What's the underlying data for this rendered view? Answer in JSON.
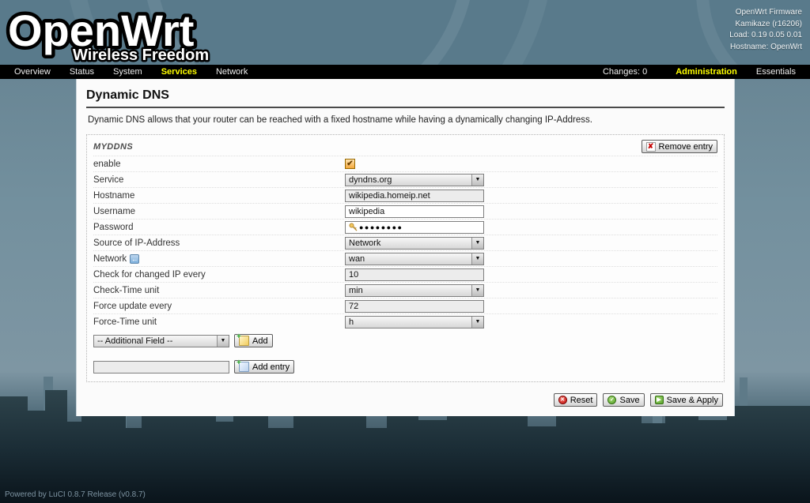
{
  "header": {
    "logo_title": "OpenWrt",
    "logo_subtitle": "Wireless Freedom",
    "info_lines": [
      "OpenWrt Firmware",
      "Kamikaze (r16206)",
      "Load: 0.19 0.05 0.01",
      "Hostname: OpenWrt"
    ]
  },
  "nav": {
    "items": [
      "Overview",
      "Status",
      "System",
      "Services",
      "Network"
    ],
    "active_item": "Services",
    "changes": "Changes: 0",
    "right_items": [
      "Administration",
      "Essentials"
    ],
    "accent_color": "#ffff00"
  },
  "page": {
    "title": "Dynamic DNS",
    "description": "Dynamic DNS allows that your router can be reached with a fixed hostname while having a dynamically changing IP-Address.",
    "section": {
      "name": "MYDDNS",
      "remove_button": "Remove entry",
      "rows": [
        {
          "id": "enable",
          "label": "enable",
          "type": "checkbox",
          "checked": true
        },
        {
          "id": "service",
          "label": "Service",
          "type": "select",
          "value": "dyndns.org"
        },
        {
          "id": "hostname",
          "label": "Hostname",
          "type": "text",
          "value": "wikipedia.homeip.net",
          "shaded": true
        },
        {
          "id": "username",
          "label": "Username",
          "type": "text",
          "value": "wikipedia"
        },
        {
          "id": "password",
          "label": "Password",
          "type": "password",
          "value": "●●●●●●●●"
        },
        {
          "id": "ip-source",
          "label": "Source of IP-Address",
          "type": "select",
          "value": "Network"
        },
        {
          "id": "network",
          "label": "Network",
          "type": "select",
          "value": "wan",
          "revert_icon": true
        },
        {
          "id": "check-interval",
          "label": "Check for changed IP every",
          "type": "text",
          "value": "10",
          "shaded": true
        },
        {
          "id": "check-unit",
          "label": "Check-Time unit",
          "type": "select",
          "value": "min"
        },
        {
          "id": "force-interval",
          "label": "Force update every",
          "type": "text",
          "value": "72",
          "shaded": true
        },
        {
          "id": "force-unit",
          "label": "Force-Time unit",
          "type": "select",
          "value": "h"
        }
      ],
      "additional_field": {
        "select_value": "-- Additional Field --",
        "add_button": "Add"
      },
      "add_entry": {
        "input_value": "",
        "button": "Add entry"
      }
    },
    "actions": {
      "reset": "Reset",
      "save": "Save",
      "save_apply": "Save & Apply"
    }
  },
  "footer": {
    "text": "Powered by LuCI 0.8.7 Release (v0.8.7)"
  }
}
